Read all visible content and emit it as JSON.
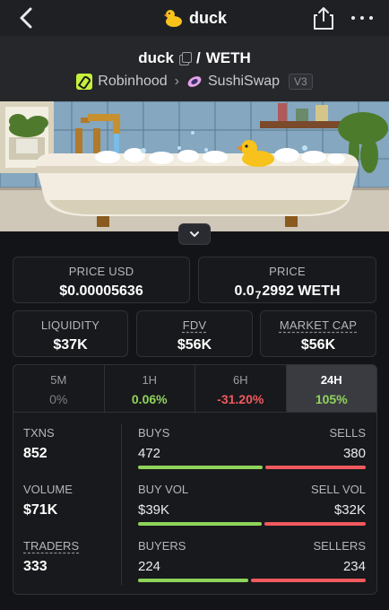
{
  "nav": {
    "title": "duck",
    "icons": {
      "back": "chevron-left-icon",
      "share": "share-icon",
      "more": "more-dots-icon",
      "token": "duck-emoji-icon"
    }
  },
  "pair": {
    "base": "duck",
    "separator": "/",
    "quote": "WETH",
    "chain": "Robinhood",
    "dex": "SushiSwap",
    "version": "V3"
  },
  "stats": {
    "price_usd": {
      "label": "PRICE USD",
      "value": "$0.00005636"
    },
    "price_native": {
      "label": "PRICE",
      "prefix": "0.0",
      "zeros": "7",
      "suffix": "2992 WETH"
    },
    "liquidity": {
      "label": "LIQUIDITY",
      "value": "$37K"
    },
    "fdv": {
      "label": "FDV",
      "value": "$56K"
    },
    "market_cap": {
      "label": "MARKET CAP",
      "value": "$56K"
    }
  },
  "timeframes": [
    {
      "label": "5M",
      "change": "0%"
    },
    {
      "label": "1H",
      "change": "0.06%"
    },
    {
      "label": "6H",
      "change": "-31.20%"
    },
    {
      "label": "24H",
      "change": "105%"
    }
  ],
  "active_timeframe": "24H",
  "txns": {
    "txns": {
      "label": "TXNS",
      "value": "852"
    },
    "volume": {
      "label": "VOLUME",
      "value": "$71K"
    },
    "traders": {
      "label": "TRADERS",
      "value": "333"
    },
    "buys_sells": {
      "left_label": "BUYS",
      "right_label": "SELLS",
      "left_value": "472",
      "right_value": "380",
      "buy_ratio": 0.554
    },
    "vol_split": {
      "left_label": "BUY VOL",
      "right_label": "SELL VOL",
      "left_value": "$39K",
      "right_value": "$32K",
      "buy_ratio": 0.55
    },
    "buyers_sellers": {
      "left_label": "BUYERS",
      "right_label": "SELLERS",
      "left_value": "224",
      "right_value": "234",
      "buy_ratio": 0.489
    }
  },
  "colors": {
    "positive": "#8fd45b",
    "negative": "#f0595e",
    "background": "#131417"
  }
}
